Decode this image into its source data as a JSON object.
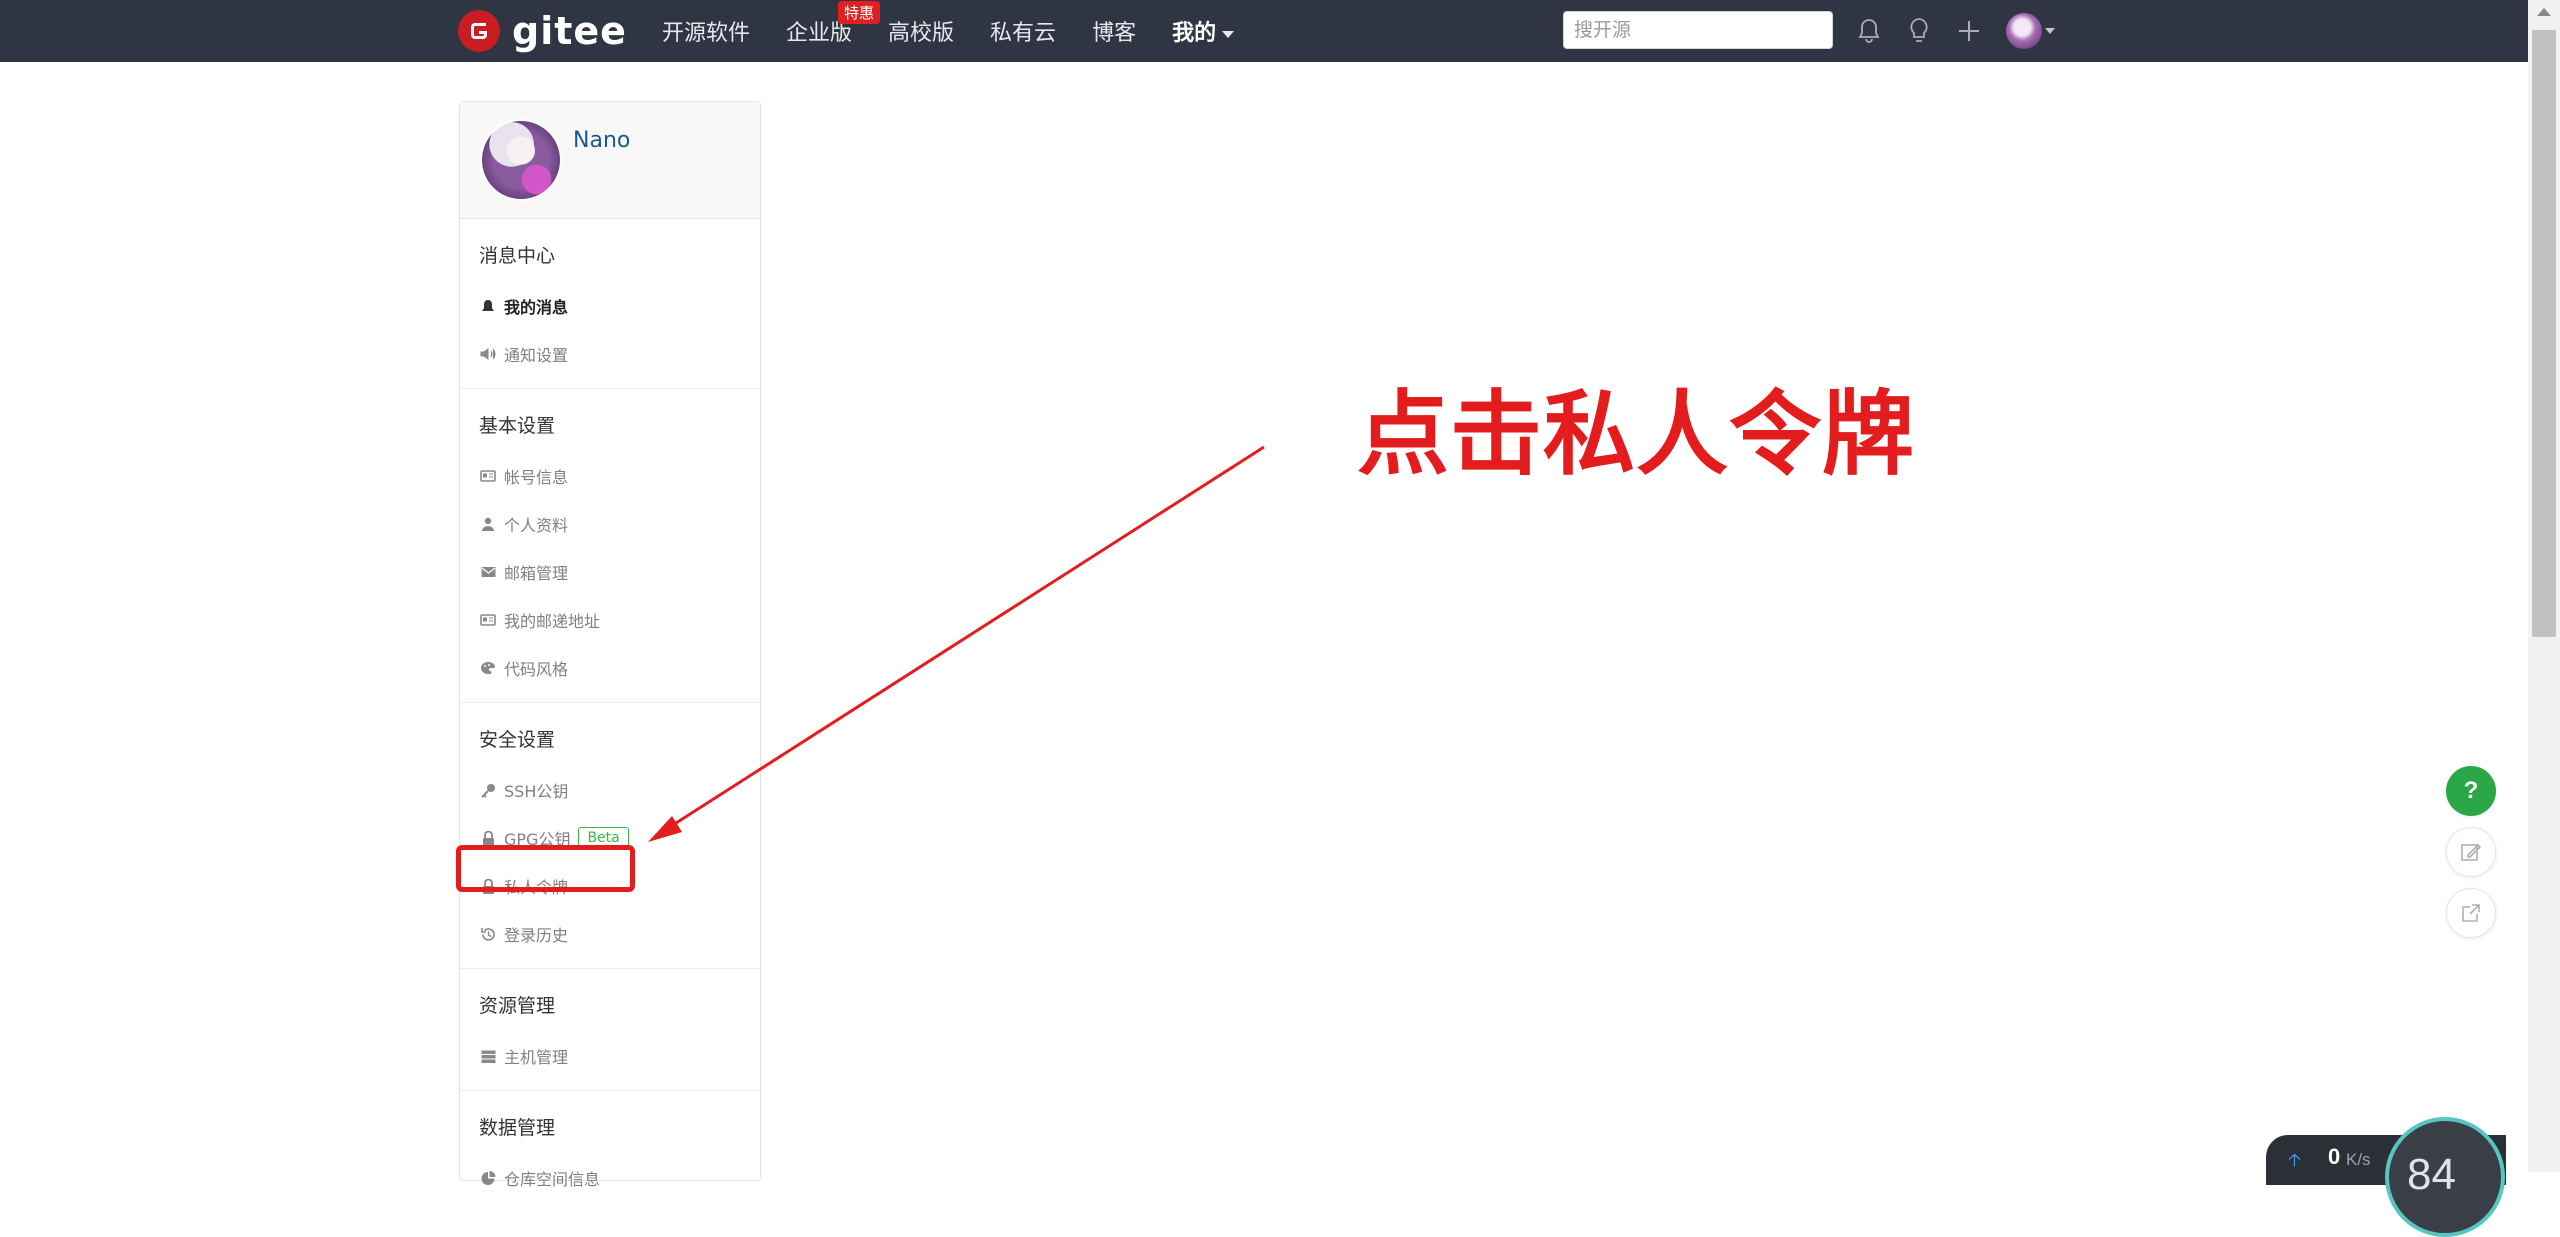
{
  "navbar": {
    "logo_text": "gitee",
    "items": [
      {
        "label": "开源软件"
      },
      {
        "label": "企业版",
        "badge": "特惠"
      },
      {
        "label": "高校版"
      },
      {
        "label": "私有云"
      },
      {
        "label": "博客"
      },
      {
        "label": "我的"
      }
    ],
    "search_placeholder": "搜开源"
  },
  "sidebar": {
    "username": "Nano",
    "sections": [
      {
        "title": "消息中心",
        "items": [
          "我的消息",
          "通知设置"
        ]
      },
      {
        "title": "基本设置",
        "items": [
          "帐号信息",
          "个人资料",
          "邮箱管理",
          "我的邮递地址",
          "代码风格"
        ]
      },
      {
        "title": "安全设置",
        "items": [
          "SSH公钥",
          "GPG公钥",
          "私人令牌",
          "登录历史"
        ],
        "beta_badge": "Beta"
      },
      {
        "title": "资源管理",
        "items": [
          "主机管理"
        ]
      },
      {
        "title": "数据管理",
        "items": [
          "仓库空间信息"
        ]
      }
    ],
    "active_item": "我的消息"
  },
  "annotation": {
    "text": "点击私人令牌",
    "color": "#e31d1d",
    "target": "私人令牌"
  },
  "floating": {
    "help_label": "?"
  },
  "network": {
    "upload_value": "0",
    "unit": "K/s",
    "gauge_value": "84"
  },
  "colors": {
    "navbar": "#2f3543",
    "brand": "#c71d23",
    "link": "#1a5b8c",
    "beta": "#3bb54a",
    "help": "#2aa847"
  }
}
